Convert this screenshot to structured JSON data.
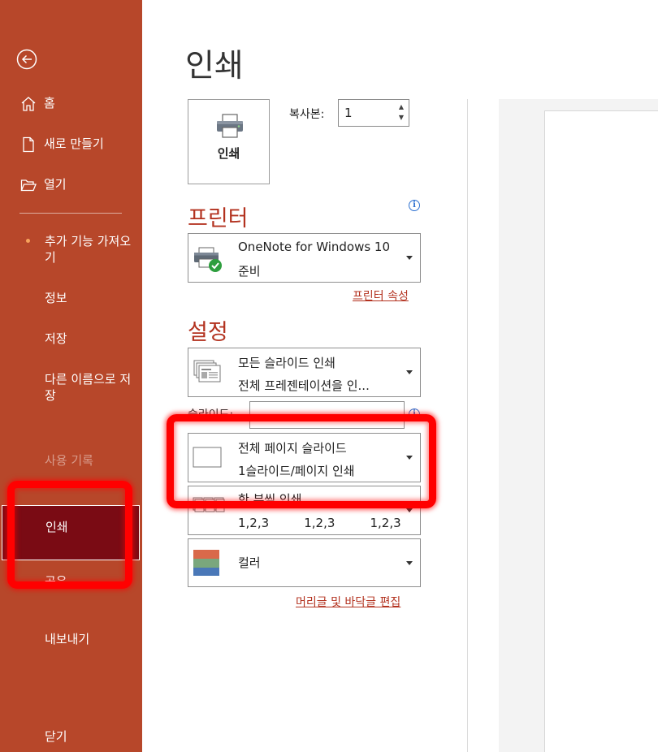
{
  "sidebar": {
    "home": "홈",
    "new": "새로 만들기",
    "open": "열기",
    "addins": "추가 기능 가져오기",
    "info": "정보",
    "save": "저장",
    "save_as": "다른 이름으로 저장",
    "history": "사용 기록",
    "print": "인쇄",
    "share": "공유",
    "export": "내보내기",
    "close": "닫기",
    "bg_color": "#b7472a",
    "selected_color": "#7a0b14"
  },
  "main": {
    "title": "인쇄",
    "print_button": "인쇄",
    "copies_label": "복사본:",
    "copies_value": "1",
    "printer_section": "프린터",
    "printer_name": "OneNote for Windows 10",
    "printer_status": "준비",
    "printer_properties": "프린터 속성",
    "settings_section": "설정",
    "slides_range_line1": "모든 슬라이드 인쇄",
    "slides_range_line2": "전체 프레젠테이션을 인...",
    "slides_label": "슬라이드:",
    "layout_line1": "전체 페이지 슬라이드",
    "layout_line2": "1슬라이드/페이지 인쇄",
    "collate_line1": "한 부씩 인쇄",
    "collate_line2": "1,2,3    1,2,3    1,2,3",
    "color": "컬러",
    "header_footer": "머리글 및 바닥글 편집",
    "accent": "#b3321f"
  }
}
